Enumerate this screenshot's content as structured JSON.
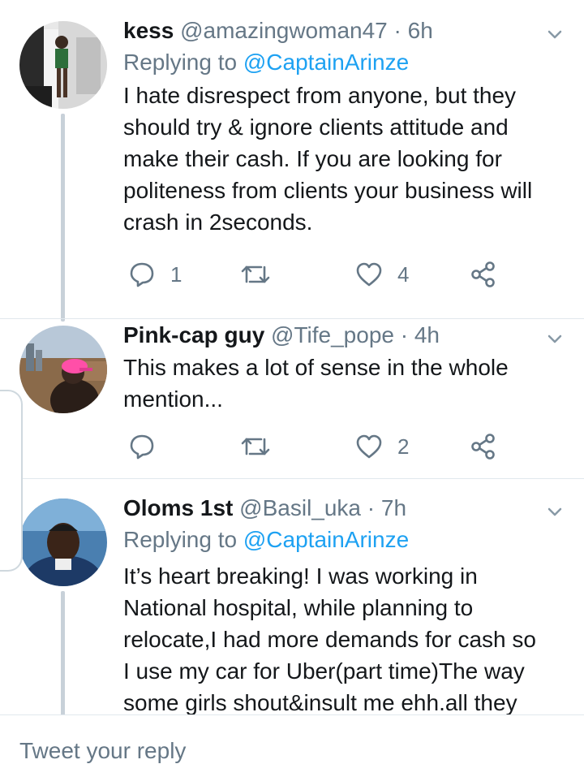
{
  "tweets": [
    {
      "name": "kess",
      "handle": "@amazingwoman47",
      "separator": "·",
      "time": "6h",
      "replying_prefix": "Replying to",
      "replying_to": "@CaptainArinze",
      "lines": [
        "I hate disrespect from anyone, but they",
        "should try & ignore clients attitude and",
        "make their cash. If you are looking for",
        "politeness from clients your business will",
        "crash in 2seconds."
      ],
      "replies": "1",
      "likes": "4"
    },
    {
      "name": "Pink-cap guy",
      "handle": "@Tife_pope",
      "separator": "·",
      "time": "4h",
      "lines": [
        "This makes a lot of sense in the whole",
        "mention..."
      ],
      "likes": "2"
    },
    {
      "name": "Oloms 1st",
      "handle": "@Basil_uka",
      "separator": "·",
      "time": "7h",
      "replying_prefix": "Replying to",
      "replying_to": "@CaptainArinze",
      "lines": [
        "It’s heart breaking! I was working in",
        "National hospital, while planning to",
        "relocate,I had more demands for cash so",
        "I use my car for Uber(part time)The way",
        "some girls shout&insult me ehh.all they"
      ]
    }
  ],
  "reply_placeholder": "Tweet your reply",
  "icons": {
    "reply": "reply-icon",
    "retweet": "retweet-icon",
    "like": "heart-icon",
    "share": "share-icon",
    "caret": "chevron-down-icon"
  },
  "colors": {
    "link": "#1da1f2",
    "muted": "#657786",
    "text": "#14171a",
    "thread": "#c8d1d9"
  }
}
